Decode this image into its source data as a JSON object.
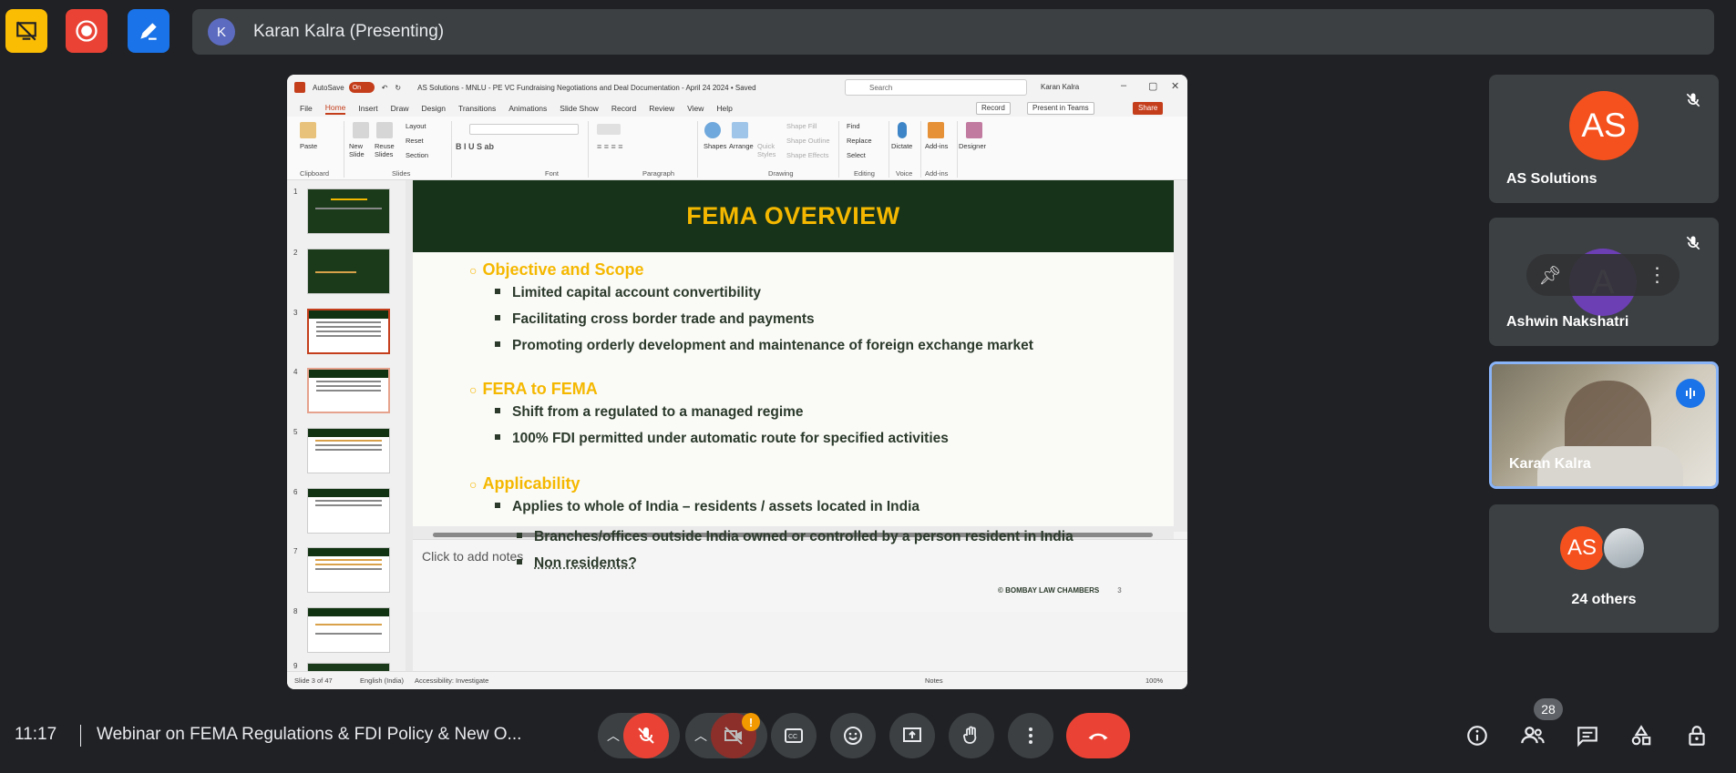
{
  "presenter": {
    "initial": "K",
    "label": "Karan Kalra (Presenting)"
  },
  "ppt": {
    "autosave_label": "AutoSave",
    "autosave_state": "On",
    "doc_title": "AS Solutions - MNLU - PE VC Fundraising Negotiations and Deal Documentation - April 24 2024 • Saved",
    "search_placeholder": "Search",
    "user": "Karan Kalra",
    "menu": [
      "File",
      "Home",
      "Insert",
      "Draw",
      "Design",
      "Transitions",
      "Animations",
      "Slide Show",
      "Record",
      "Review",
      "View",
      "Help"
    ],
    "record_btn": "Record",
    "present_teams_btn": "Present in Teams",
    "share_btn": "Share",
    "ribbon_groups": [
      "Clipboard",
      "Slides",
      "Font",
      "Paragraph",
      "Drawing",
      "Editing",
      "Voice",
      "Add-ins"
    ],
    "ribbon_labels": {
      "paste": "Paste",
      "new_slide": "New Slide",
      "reuse": "Reuse Slides",
      "layout": "Layout",
      "reset": "Reset",
      "section": "Section",
      "shapes": "Shapes",
      "arrange": "Arrange",
      "quick_styles": "Quick Styles",
      "shape_fill": "Shape Fill",
      "shape_outline": "Shape Outline",
      "shape_effects": "Shape Effects",
      "find": "Find",
      "replace": "Replace",
      "select": "Select",
      "dictate": "Dictate",
      "addins": "Add-ins",
      "designer": "Designer"
    },
    "thumb_numbers": [
      "1",
      "2",
      "3",
      "4",
      "5",
      "6",
      "7",
      "8",
      "9"
    ],
    "slide": {
      "title": "FEMA OVERVIEW",
      "sections": [
        {
          "heading": "Objective and Scope",
          "bullets": [
            "Limited capital account convertibility",
            "Facilitating cross border trade and payments",
            "Promoting orderly development and maintenance of foreign exchange market"
          ]
        },
        {
          "heading": "FERA to FEMA",
          "bullets": [
            "Shift from a regulated to a managed regime",
            "100% FDI permitted under automatic route for specified activities"
          ]
        },
        {
          "heading": "Applicability",
          "bullets": [
            "Applies to whole of India – residents / assets located in India",
            "Branches/offices outside India owned or controlled by a person resident in India",
            "Non residents?"
          ]
        }
      ],
      "footer": "© BOMBAY LAW CHAMBERS",
      "page": "3"
    },
    "notes_placeholder": "Click to add notes",
    "status": {
      "slide": "Slide 3 of 47",
      "language": "English (India)",
      "accessibility": "Accessibility: Investigate",
      "notes": "Notes",
      "zoom": "100%"
    }
  },
  "participants": [
    {
      "name": "AS Solutions",
      "initials": "AS",
      "color": "#f4511e"
    },
    {
      "name": "Ashwin Nakshatri",
      "initials": "A"
    },
    {
      "name": "Karan Kalra"
    },
    {
      "name": "24 others",
      "initials": "AS"
    }
  ],
  "bottom": {
    "time": "11:17",
    "title": "Webinar on FEMA Regulations & FDI Policy & New O...",
    "people_count": "28",
    "alert": "!"
  },
  "colors": {
    "accent_red": "#ea4335",
    "slide_green": "#17331a",
    "slide_gold": "#f5b800",
    "ppt_brand": "#c43e1c"
  }
}
